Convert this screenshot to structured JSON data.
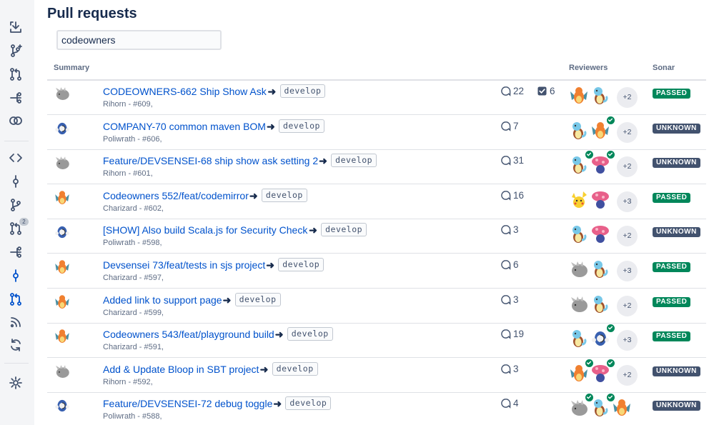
{
  "page_title": "Pull requests",
  "search": {
    "value": "codeowners",
    "placeholder": ""
  },
  "columns": {
    "summary": "Summary",
    "reviewers": "Reviewers",
    "sonar": "Sonar"
  },
  "sidebar": {
    "items": [
      {
        "icon": "download-icon"
      },
      {
        "icon": "branch-plus-icon"
      },
      {
        "icon": "pull-request-icon"
      },
      {
        "icon": "pipeline-icon"
      },
      {
        "icon": "compare-icon"
      },
      {
        "icon": "code-icon"
      },
      {
        "icon": "commit-icon"
      },
      {
        "icon": "branch-icon"
      },
      {
        "icon": "pull-request-icon",
        "badge": "2"
      },
      {
        "icon": "pipeline-icon"
      },
      {
        "icon": "commit-icon",
        "active": true
      },
      {
        "icon": "pull-request-icon",
        "active": true
      },
      {
        "icon": "rss-icon"
      },
      {
        "icon": "sync-icon"
      },
      {
        "icon": "gear-icon"
      }
    ]
  },
  "pull_requests": [
    {
      "title": "CODEOWNERS-662 Ship Show Ask",
      "target": "develop",
      "meta": "Rihorn - #609,",
      "author": "rhyhorn",
      "comments": "22",
      "tasks": "6",
      "reviewers": [
        {
          "a": "charizard",
          "ok": false
        },
        {
          "a": "squirtle",
          "ok": false
        }
      ],
      "more": "+2",
      "sonar": "PASSED"
    },
    {
      "title": "COMPANY-70 common maven BOM",
      "target": "develop",
      "meta": "Poliwrath - #606,",
      "author": "poliwrath",
      "comments": "7",
      "tasks": "",
      "reviewers": [
        {
          "a": "squirtle",
          "ok": false
        },
        {
          "a": "charizard",
          "ok": true
        }
      ],
      "more": "+2",
      "sonar": "UNKNOWN"
    },
    {
      "title": "Feature/DEVSENSEI-68 ship show ask setting 2",
      "target": "develop",
      "meta": "Rihorn - #601,",
      "author": "rhyhorn",
      "comments": "31",
      "tasks": "",
      "reviewers": [
        {
          "a": "squirtle",
          "ok": true
        },
        {
          "a": "vileplume",
          "ok": true
        }
      ],
      "more": "+2",
      "sonar": "UNKNOWN"
    },
    {
      "title": "Codeowners 552/feat/codemirror",
      "target": "develop",
      "meta": "Charizard - #602,",
      "author": "charizard",
      "comments": "16",
      "tasks": "",
      "reviewers": [
        {
          "a": "pikachu",
          "ok": false
        },
        {
          "a": "vileplume",
          "ok": false
        }
      ],
      "more": "+3",
      "sonar": "PASSED"
    },
    {
      "title": "[SHOW] Also build Scala.js for Security Check",
      "target": "develop",
      "meta": "Poliwrath - #598,",
      "author": "poliwrath",
      "comments": "3",
      "tasks": "",
      "reviewers": [
        {
          "a": "squirtle",
          "ok": false
        },
        {
          "a": "vileplume",
          "ok": false
        }
      ],
      "more": "+2",
      "sonar": "UNKNOWN"
    },
    {
      "title": "Devsensei 73/feat/tests in sjs project",
      "target": "develop",
      "meta": "Charizard - #597,",
      "author": "charizard",
      "comments": "6",
      "tasks": "",
      "reviewers": [
        {
          "a": "rhyhorn",
          "ok": false
        },
        {
          "a": "squirtle",
          "ok": false
        }
      ],
      "more": "+3",
      "sonar": "PASSED"
    },
    {
      "title": "Added link to support page",
      "target": "develop",
      "meta": "Charizard - #599,",
      "author": "charizard",
      "comments": "3",
      "tasks": "",
      "reviewers": [
        {
          "a": "rhyhorn",
          "ok": false
        },
        {
          "a": "squirtle",
          "ok": false
        }
      ],
      "more": "+2",
      "sonar": "PASSED"
    },
    {
      "title": "Codeowners 543/feat/playground build",
      "target": "develop",
      "meta": "Charizard - #591,",
      "author": "charizard",
      "comments": "19",
      "tasks": "",
      "reviewers": [
        {
          "a": "squirtle",
          "ok": false
        },
        {
          "a": "poliwrath",
          "ok": true
        }
      ],
      "more": "+3",
      "sonar": "PASSED"
    },
    {
      "title": "Add & Update Bloop in SBT project",
      "target": "develop",
      "meta": "Rihorn - #592,",
      "author": "rhyhorn",
      "comments": "3",
      "tasks": "",
      "reviewers": [
        {
          "a": "charizard",
          "ok": true
        },
        {
          "a": "vileplume",
          "ok": true
        }
      ],
      "more": "+2",
      "sonar": "UNKNOWN"
    },
    {
      "title": "Feature/DEVSENSEI-72 debug toggle",
      "target": "develop",
      "meta": "Poliwrath - #588,",
      "author": "poliwrath",
      "comments": "4",
      "tasks": "",
      "reviewers": [
        {
          "a": "rhyhorn",
          "ok": true
        },
        {
          "a": "squirtle",
          "ok": true
        },
        {
          "a": "charizard",
          "ok": false
        }
      ],
      "more": "",
      "sonar": "UNKNOWN"
    }
  ],
  "colors": {
    "link": "#0052cc",
    "passed": "#00875a",
    "unknown": "#42526e",
    "sidebar_active": "#0052cc",
    "sidebar_icon": "#42526e"
  }
}
